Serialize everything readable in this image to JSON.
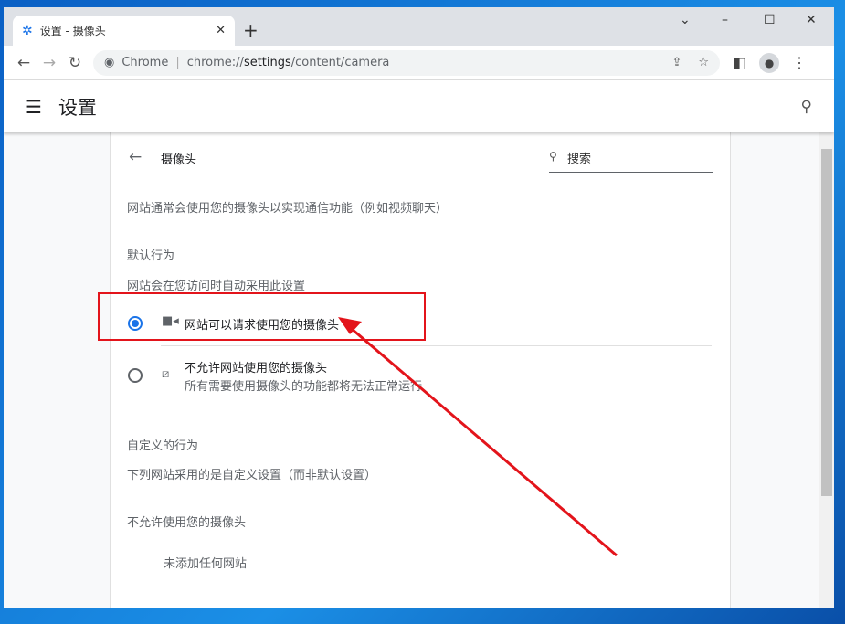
{
  "browser": {
    "tab_title": "设置 - 摄像头",
    "omnibox_label": "Chrome",
    "url_prefix": "chrome://",
    "url_host": "settings",
    "url_path": "/content/camera"
  },
  "header": {
    "title": "设置"
  },
  "page": {
    "title": "摄像头",
    "search_placeholder": "搜索",
    "description": "网站通常会使用您的摄像头以实现通信功能（例如视频聊天）",
    "default_heading": "默认行为",
    "default_sub": "网站会在您访问时自动采用此设置",
    "options": [
      {
        "label": "网站可以请求使用您的摄像头",
        "selected": true
      },
      {
        "label": "不允许网站使用您的摄像头",
        "sublabel": "所有需要使用摄像头的功能都将无法正常运行",
        "selected": false
      }
    ],
    "custom_heading": "自定义的行为",
    "custom_sub": "下列网站采用的是自定义设置（而非默认设置）",
    "blocked_heading": "不允许使用您的摄像头",
    "blocked_empty": "未添加任何网站"
  },
  "annotation_color": "#e3141b"
}
